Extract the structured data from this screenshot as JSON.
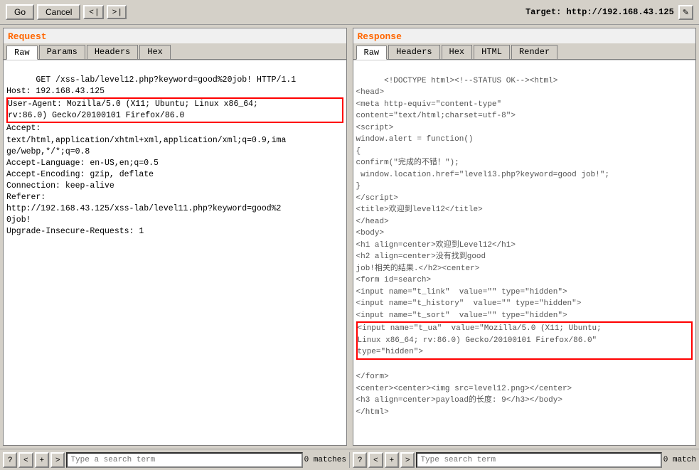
{
  "toolbar": {
    "go_label": "Go",
    "cancel_label": "Cancel",
    "back_label": "< |",
    "forward_label": "> |",
    "target_label": "Target: http://192.168.43.125",
    "edit_icon": "✎"
  },
  "request_panel": {
    "title": "Request",
    "tabs": [
      "Raw",
      "Params",
      "Headers",
      "Hex"
    ],
    "active_tab": "Raw",
    "content": "GET /xss-lab/level12.php?keyword=good%20job! HTTP/1.1\nHost: 192.168.43.125\nUser-Agent: Mozilla/5.0 (X11; Ubuntu; Linux x86_64;\nrv:86.0) Gecko/20100101 Firefox/86.0\nAccept:\ntext/html,application/xhtml+xml,application/xml;q=0.9,ima\nge/webp,*/*;q=0.8\nAccept-Language: en-US,en;q=0.5\nAccept-Encoding: gzip, deflate\nConnection: keep-alive\nReferer:\nhttp://192.168.43.125/xss-lab/level11.php?keyword=good%2\n0job!\nUpgrade-Insecure-Requests: 1",
    "ua_line": "User-Agent: Mozilla/5.0 (X11; Ubuntu; Linux x86_64;\nrv:86.0) Gecko/20100101 Firefox/86.0"
  },
  "response_panel": {
    "title": "Response",
    "tabs": [
      "Raw",
      "Headers",
      "Hex",
      "HTML",
      "Render"
    ],
    "active_tab": "Raw",
    "content_lines": [
      "<!DOCTYPE html><!--STATUS OK--><html>",
      "<head>",
      "<meta http-equiv=\"content-type\"",
      "content=\"text/html;charset=utf-8\">",
      "<script>",
      "window.alert = function()",
      "{",
      "confirm(\"完成的不错！\");",
      " window.location.href=\"level13.php?keyword=good job!\";",
      "}",
      "<\\/script>",
      "<title>欢迎到level12<\\/title>",
      "<\\/head>",
      "<body>",
      "<h1 align=center>欢迎到Level12<\\/h1>",
      "<h2 align=center>没有找到good",
      "job!相关的结果.<\\/h2><center>",
      "<form id=search>",
      "<input name=\"t_link\"  value=\"\" type=\"hidden\">",
      "<input name=\"t_history\"  value=\"\" type=\"hidden\">",
      "<input name=\"t_sort\"  value=\"\" type=\"hidden\">",
      "<input name=\"t_ua\"  value=\"Mozilla/5.0 (X11; Ubuntu;",
      "Linux x86_64; rv:86.0) Gecko/20100101 Firefox/86.0\"",
      "type=\"hidden\">",
      "<\\/form>",
      "<center><center><img src=level12.png><\\/center>",
      "<h3 align=center>payload的长度: 9<\\/h3><\\/body>",
      "<\\/html>"
    ],
    "ua_highlight_start": 21,
    "ua_highlight_end": 23
  },
  "bottom_bar": {
    "left": {
      "search_placeholder": "Type a search term",
      "match_count": "0 matches"
    },
    "right": {
      "search_placeholder": "Type search term",
      "match_count": "0 match"
    }
  }
}
